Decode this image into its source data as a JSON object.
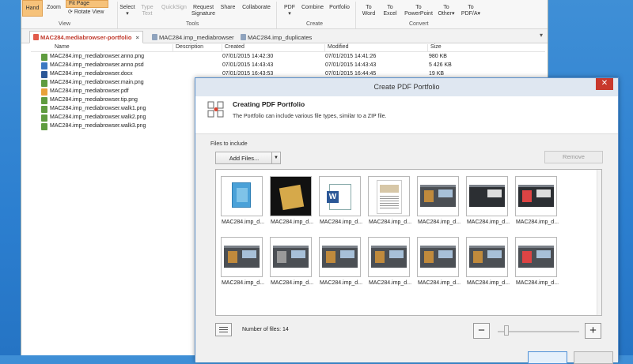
{
  "ribbon": {
    "view": {
      "hand": "Hand",
      "zoom": "Zoom",
      "fit_page": "Fit Page",
      "rotate_view": "Rotate View",
      "group": "View"
    },
    "tools": {
      "select": "Select",
      "type_text_1": "Type",
      "type_text_2": "Text",
      "quicksign": "QuickSign",
      "request_1": "Request",
      "request_2": "Signature",
      "share": "Share",
      "collaborate": "Collaborate",
      "group": "Tools"
    },
    "create": {
      "pdf": "PDF",
      "combine": "Combine",
      "portfolio": "Portfolio",
      "group": "Create"
    },
    "convert": {
      "to": "To",
      "word": "Word",
      "excel": "Excel",
      "powerpoint": "PowerPoint",
      "other": "Other",
      "pdfa": "PDF/A",
      "group": "Convert"
    }
  },
  "tabs": [
    {
      "label": "MAC284.mediabrowser-portfolio",
      "close": "×"
    },
    {
      "label": "MAC284.imp_mediabrowser"
    },
    {
      "label": "MAC284.imp_duplicates"
    }
  ],
  "file_list": {
    "columns": [
      "Name",
      "Description",
      "Created",
      "Modified",
      "Size"
    ],
    "rows": [
      {
        "name": "MAC284.imp_mediabrowser.anno.png",
        "created": "07/01/2015 14:42:30",
        "modified": "07/01/2015 14:41:26",
        "size": "980 KB"
      },
      {
        "name": "MAC284.imp_mediabrowser.anno.psd",
        "created": "07/01/2015 14:43:43",
        "modified": "07/01/2015 14:43:43",
        "size": "5 426 KB"
      },
      {
        "name": "MAC284.imp_mediabrowser.docx",
        "created": "07/01/2015 16:43:53",
        "modified": "07/01/2015 16:44:45",
        "size": "19 KB"
      },
      {
        "name": "MAC284.imp_mediabrowser.main.png",
        "created": "",
        "modified": "",
        "size": ""
      },
      {
        "name": "MAC284.imp_mediabrowser.pdf",
        "created": "",
        "modified": "",
        "size": ""
      },
      {
        "name": "MAC284.imp_mediabrowser.tip.png",
        "created": "",
        "modified": "",
        "size": ""
      },
      {
        "name": "MAC284.imp_mediabrowser.walk1.png",
        "created": "",
        "modified": "",
        "size": ""
      },
      {
        "name": "MAC284.imp_mediabrowser.walk2.png",
        "created": "",
        "modified": "",
        "size": ""
      },
      {
        "name": "MAC284.imp_mediabrowser.walk3.png",
        "created": "",
        "modified": "",
        "size": ""
      }
    ]
  },
  "dialog": {
    "title": "Create PDF Portfolio",
    "close": "✕",
    "heading": "Creating PDF Portfolio",
    "subtitle": "The Portfolio can include various file types, similar to a ZIP file.",
    "files_label": "Files to include",
    "add_files": "Add Files...",
    "remove": "Remove",
    "thumb_label": "MAC284.imp_d...",
    "num_files": "Number of files: 14",
    "zoom_out": "−",
    "zoom_in": "+",
    "zoom_level": 0.08
  }
}
